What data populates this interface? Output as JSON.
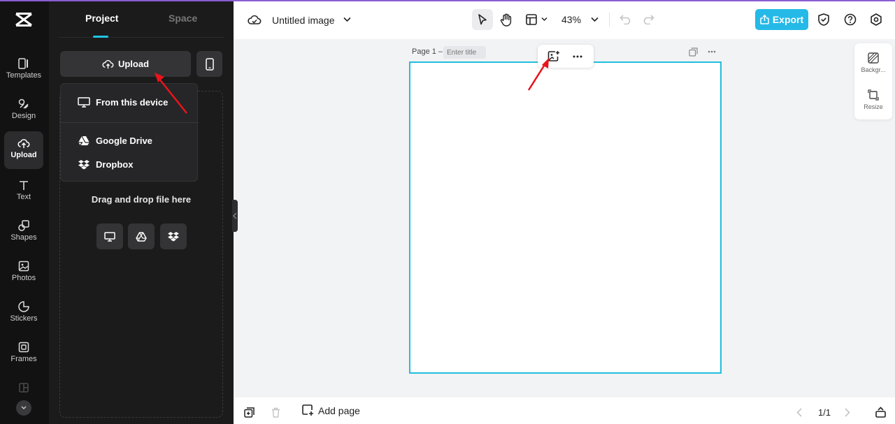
{
  "app": {
    "accent_color": "#25b9e7",
    "selection_color": "#22bfdc"
  },
  "rail": {
    "items": [
      {
        "label": "Templates",
        "icon": "templates-icon"
      },
      {
        "label": "Design",
        "icon": "design-icon"
      },
      {
        "label": "Upload",
        "icon": "upload-cloud-icon",
        "active": true
      },
      {
        "label": "Text",
        "icon": "text-icon"
      },
      {
        "label": "Shapes",
        "icon": "shapes-icon"
      },
      {
        "label": "Photos",
        "icon": "photos-icon"
      },
      {
        "label": "Stickers",
        "icon": "stickers-icon"
      },
      {
        "label": "Frames",
        "icon": "frames-icon"
      }
    ]
  },
  "panel": {
    "tabs": {
      "project": "Project",
      "space": "Space"
    },
    "upload_label": "Upload",
    "menu": {
      "from_device": "From this device",
      "google_drive": "Google Drive",
      "dropbox": "Dropbox"
    },
    "drop_text": "Drag and drop file here"
  },
  "topbar": {
    "doc_title": "Untitled image",
    "zoom": "43%",
    "export_label": "Export"
  },
  "canvas": {
    "page_label": "Page 1 –",
    "title_placeholder": "Enter title"
  },
  "side_tools": {
    "background": "Backgr...",
    "resize": "Resize"
  },
  "bottombar": {
    "add_page": "Add page",
    "pager": "1/1"
  }
}
